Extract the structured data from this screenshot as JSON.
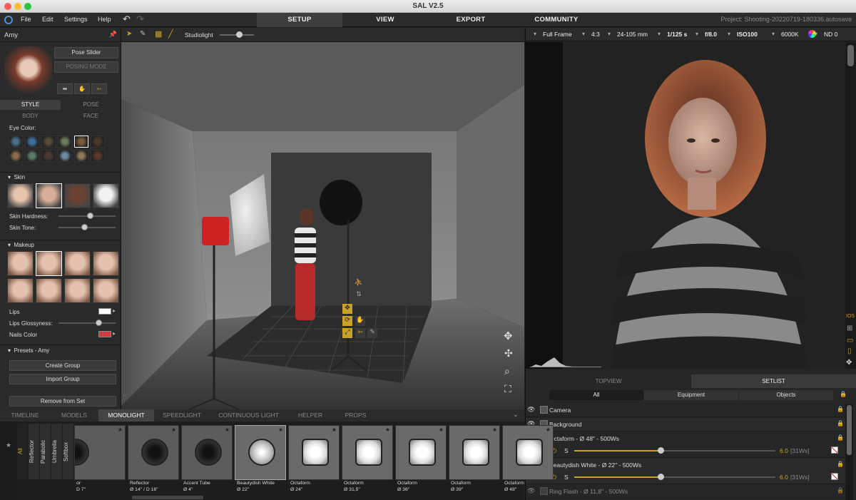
{
  "app": {
    "title": "SAL V2.5",
    "project": "Project: Shooting-20220719-180336.autosave"
  },
  "menu": [
    "File",
    "Edit",
    "Settings",
    "Help"
  ],
  "main_tabs": [
    "SETUP",
    "VIEW",
    "EXPORT",
    "COMMUNITY"
  ],
  "active_main_tab": "SETUP",
  "character": {
    "name": "Amy",
    "pose_slider": "Pose Slider",
    "posing_mode": "POSING MODE"
  },
  "style_tabs": [
    "STYLE",
    "POSE",
    "BODY",
    "FACE"
  ],
  "eye_color_label": "Eye Color:",
  "skin": {
    "label": "Skin",
    "hardness_label": "Skin Hardness:",
    "tone_label": "Skin Tone:",
    "hardness": 0.55,
    "tone": 0.45
  },
  "makeup": {
    "label": "Makeup",
    "lips": "Lips",
    "lips_glossyness": "Lips Glossyness:",
    "nails_color": "Nails Color",
    "glossyness": 0.7
  },
  "presets": {
    "label": "Presets - Amy",
    "create": "Create Group",
    "import": "Import Group",
    "remove": "Remove from Set"
  },
  "viewport_toolbar": {
    "studiolight": "Studiolight"
  },
  "camera_bar": [
    "Full Frame",
    "4:3",
    "24-105 mm",
    "1/125 s",
    "f/8.0",
    "ISO100",
    "6000K",
    "ND 0"
  ],
  "right_tabs": [
    "TOPVIEW",
    "SETLIST"
  ],
  "active_right_tab": "SETLIST",
  "filter_tabs": [
    "All",
    "Equipment",
    "Objects"
  ],
  "setlist": [
    {
      "name": "Camera"
    },
    {
      "name": "Background"
    },
    {
      "name": "Octaform - Ø 48\" - 500Ws",
      "power": "6.0",
      "ws": "[31Ws]",
      "s": "S",
      "level": 0.43
    },
    {
      "name": "Beautydish White - Ø 22\" - 500Ws",
      "power": "6.0",
      "ws": "[31Ws]",
      "s": "S",
      "level": 0.43
    },
    {
      "name": "Ring Flash - Ø 11,8\" - 500Ws"
    }
  ],
  "bottom_tabs": [
    "TIMELINE",
    "MODELS",
    "MONOLIGHT",
    "SPEEDLIGHT",
    "CONTINUOUS LIGHT",
    "HELPER",
    "PROPS"
  ],
  "active_bottom_tab": "MONOLIGHT",
  "side_categories": [
    "All",
    "Reflector",
    "Parabolic",
    "Umbrella",
    "Softbox"
  ],
  "cards": [
    {
      "l1": "or",
      "l2": "D 7\""
    },
    {
      "l1": "Reflector",
      "l2": "Ø 14\" / D 16\""
    },
    {
      "l1": "Accent Tube",
      "l2": "Ø 4\""
    },
    {
      "l1": "Beautydish White",
      "l2": "Ø 22\""
    },
    {
      "l1": "Octaform",
      "l2": "Ø 24\""
    },
    {
      "l1": "Octaform",
      "l2": "Ø 31,5\""
    },
    {
      "l1": "Octaform",
      "l2": "Ø 36\""
    },
    {
      "l1": "Octaform",
      "l2": "Ø 39\""
    },
    {
      "l1": "Octaform",
      "l2": "Ø 48\""
    }
  ],
  "histogram": {
    "ios": "IOS"
  },
  "colors": {
    "accent": "#c9a227",
    "active_tab": "#3e3e3e",
    "nails": "#d33c3c"
  }
}
